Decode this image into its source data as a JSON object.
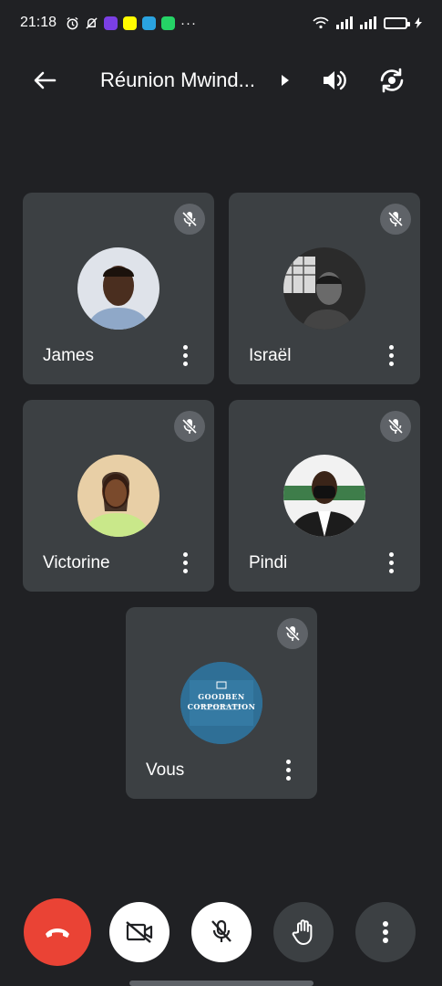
{
  "status_bar": {
    "time": "21:18",
    "battery_level": 0.8,
    "colors": {
      "battery_fill": "#2ecc40",
      "messenger": "#7b3fe4",
      "snapchat": "#fffc00",
      "telegram": "#2aa3e0",
      "whatsapp": "#25d366"
    },
    "icons": [
      "alarm-icon",
      "do-not-disturb-icon",
      "messenger-icon",
      "snapchat-icon",
      "telegram-icon",
      "whatsapp-icon",
      "more-notifications-icon",
      "wifi-icon",
      "signal-icon",
      "battery-icon"
    ]
  },
  "header": {
    "title": "Réunion Mwind...",
    "icons": [
      "back-arrow-icon",
      "expand-arrow-icon",
      "speaker-icon",
      "switch-camera-icon"
    ]
  },
  "participants": [
    {
      "name": "James",
      "muted": true
    },
    {
      "name": "Israël",
      "muted": true
    },
    {
      "name": "Victorine",
      "muted": true
    },
    {
      "name": "Pindi",
      "muted": true
    },
    {
      "name": "Vous",
      "muted": true
    }
  ],
  "self_avatar": {
    "logo_line1": "GOODBEN",
    "logo_line2": "CORPORATION"
  },
  "controls": {
    "colors": {
      "end_call": "#ea4335",
      "active_bg": "#ffffff",
      "inactive_bg": "#3c4043",
      "tile_bg": "#3c4043",
      "page_bg": "#202124"
    },
    "icons": [
      "end-call-icon",
      "camera-off-icon",
      "mic-off-icon",
      "raise-hand-icon",
      "more-options-icon"
    ]
  }
}
